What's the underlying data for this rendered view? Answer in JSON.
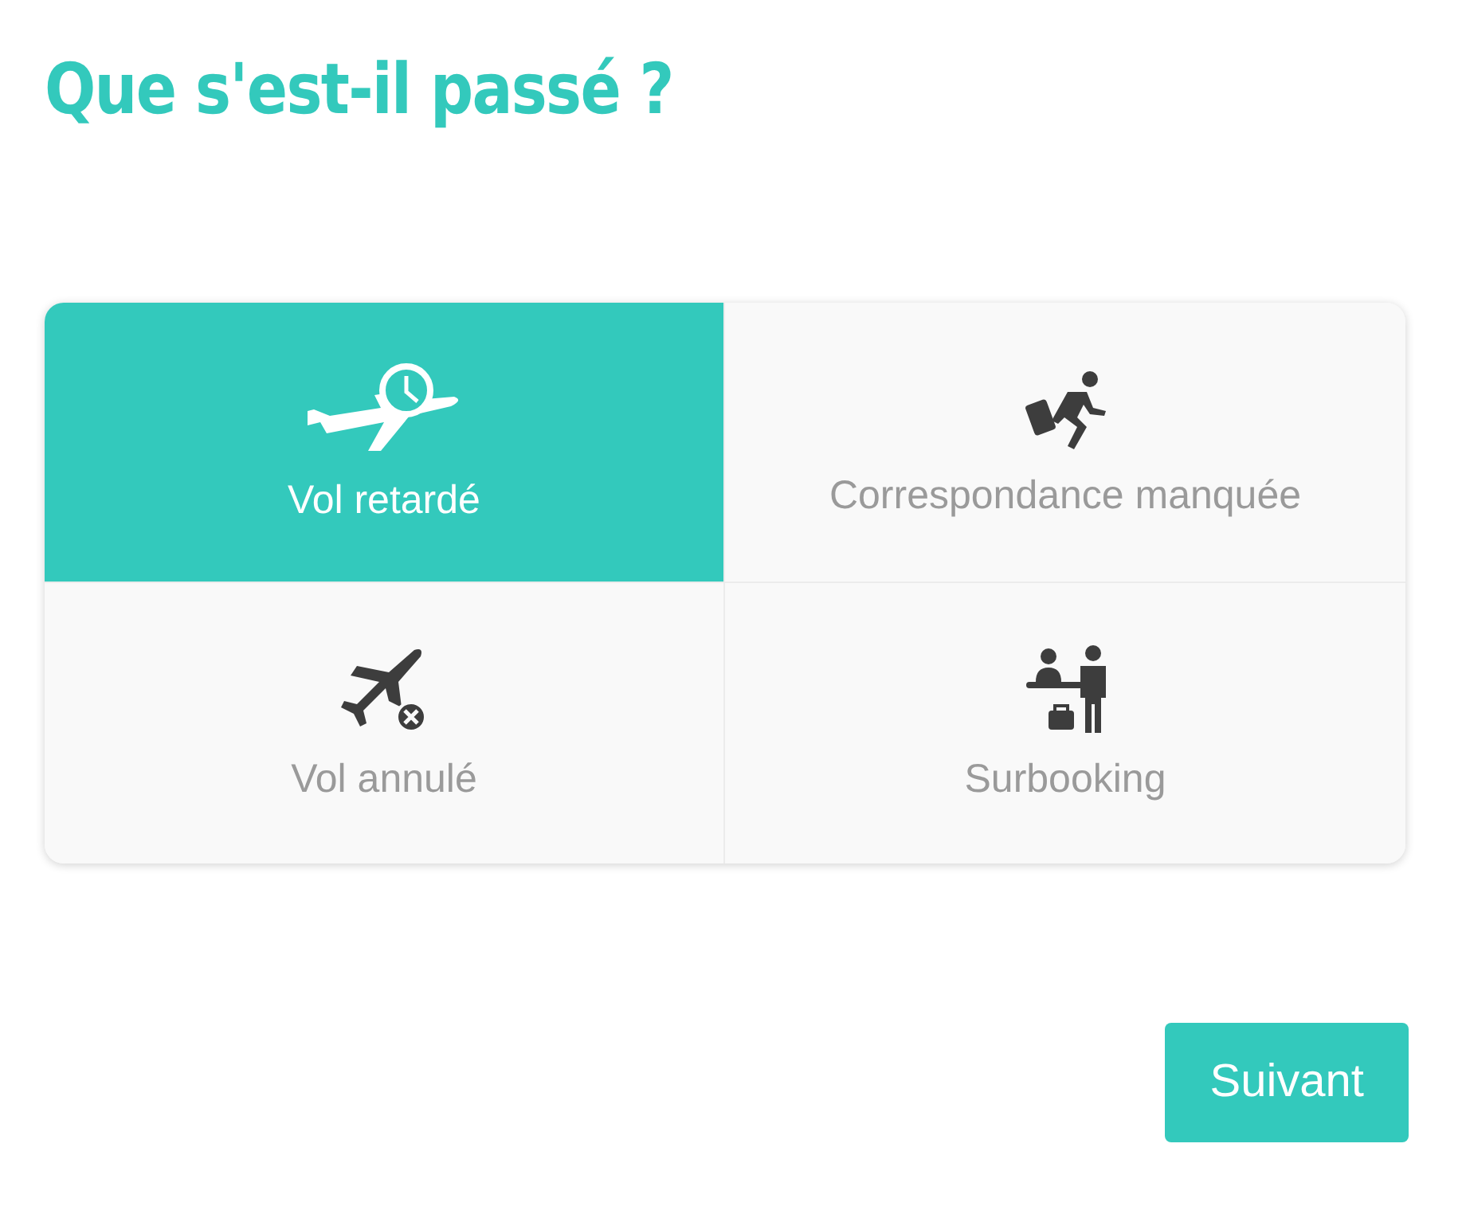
{
  "title": "Que s'est-il passé ?",
  "options": [
    {
      "kind": "delayed",
      "label": "Vol retardé",
      "selected": true
    },
    {
      "kind": "missed",
      "label": "Correspondance manquée",
      "selected": false
    },
    {
      "kind": "cancelled",
      "label": "Vol annulé",
      "selected": false
    },
    {
      "kind": "overbooking",
      "label": "Surbooking",
      "selected": false
    }
  ],
  "next_button": "Suivant"
}
